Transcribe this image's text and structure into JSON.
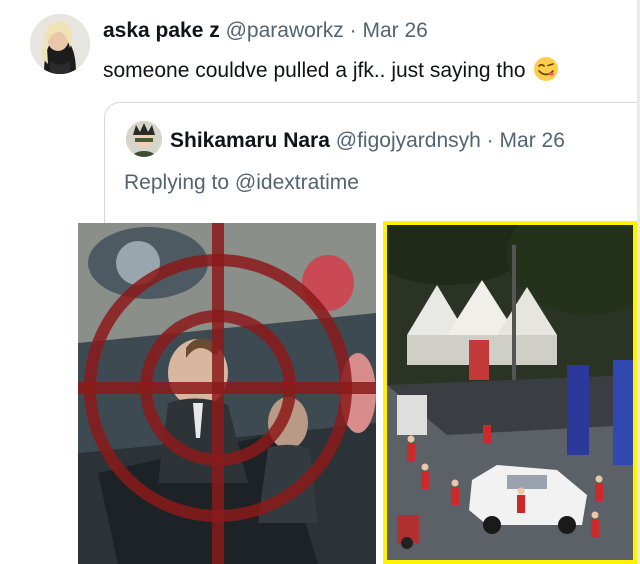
{
  "tweet": {
    "author_name": "aska pake z",
    "author_handle": "@paraworkz",
    "separator": "·",
    "date": "Mar 26",
    "text": "someone couldve pulled a jfk.. just saying tho",
    "emoji_icon": "face-savoring-food-emoji"
  },
  "quoted_tweet": {
    "author_name": "Shikamaru Nara",
    "author_handle": "@figojyardnsyh",
    "separator": "·",
    "date": "Mar 26",
    "reply_prefix": "Replying to",
    "reply_mention": "@idextratime"
  },
  "media": {
    "left_image_icon": "crosshair-overlay-photo",
    "right_image_icon": "street-convoy-photo",
    "highlight_color": "#fff200",
    "crosshair_color": "#8b1a1a"
  },
  "colors": {
    "text_primary": "#0f1419",
    "text_secondary": "#536471",
    "border": "#cfd9de"
  }
}
